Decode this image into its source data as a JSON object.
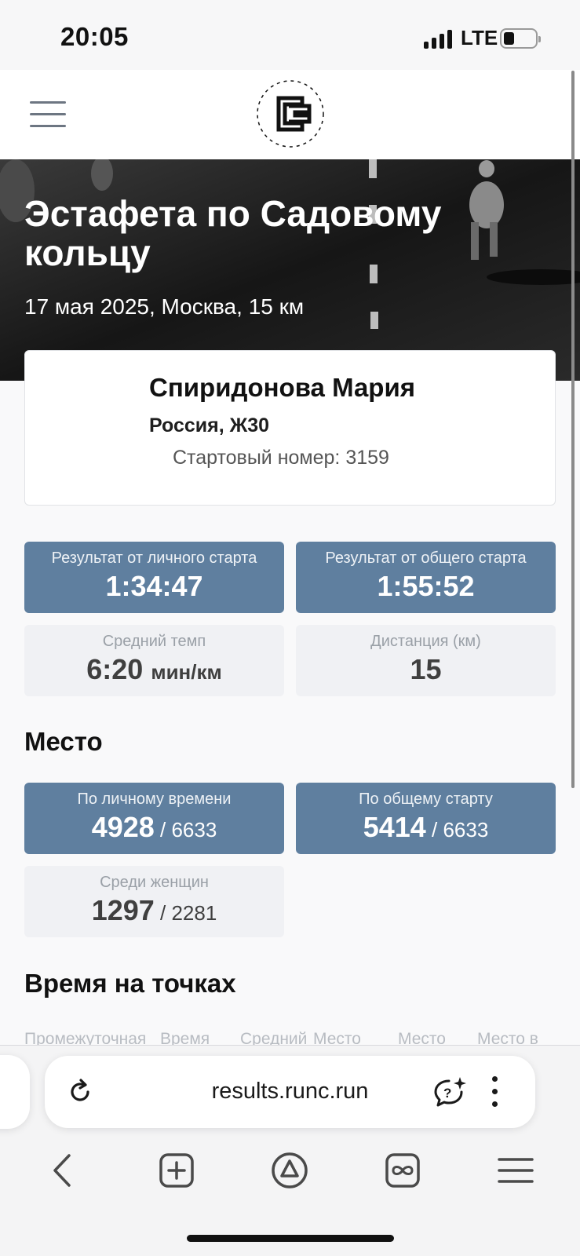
{
  "status_bar": {
    "time": "20:05",
    "network": "LTE"
  },
  "hero": {
    "title": "Эстафета по Садовому кольцу",
    "subtitle": "17 мая 2025, Москва, 15 км"
  },
  "athlete": {
    "name": "Спиридонова Мария",
    "meta": "Россия, Ж30",
    "bib": "Стартовый номер: 3159"
  },
  "results": {
    "personal": {
      "label": "Результат от личного старта",
      "value": "1:34:47"
    },
    "gun": {
      "label": "Результат от общего старта",
      "value": "1:55:52"
    },
    "pace": {
      "label": "Средний темп",
      "value": "6:20",
      "unit": "мин/км"
    },
    "distance": {
      "label": "Дистанция (км)",
      "value": "15"
    }
  },
  "place": {
    "title": "Место",
    "by_personal": {
      "label": "По личному времени",
      "value": "4928",
      "total": " / 6633"
    },
    "by_gun": {
      "label": "По общему старту",
      "value": "5414",
      "total": " / 6633"
    },
    "women": {
      "label": "Среди женщин",
      "value": "1297",
      "total": " / 2281"
    }
  },
  "splits": {
    "title": "Время на точках",
    "columns": [
      "Промежуточная",
      "Время",
      "Средний",
      "Место",
      "Место",
      "Место в"
    ]
  },
  "browser": {
    "url": "results.runc.run"
  },
  "colors": {
    "accent_tile": "#5f7f9f",
    "light_tile": "#f0f1f4"
  }
}
